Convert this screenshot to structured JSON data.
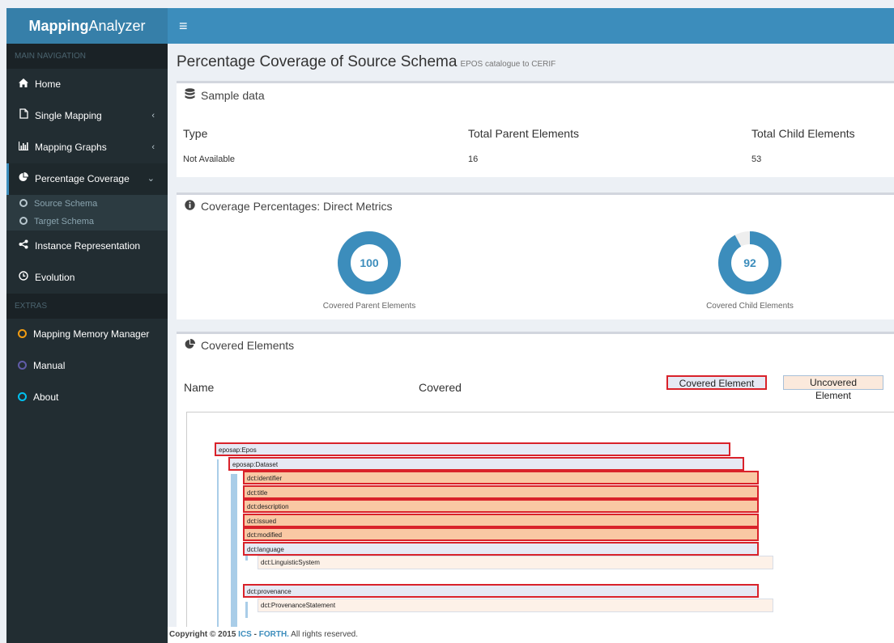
{
  "app": {
    "logo_bold": "Mapping",
    "logo_rest": "Analyzer"
  },
  "header": {
    "toggle_icon": "≡"
  },
  "sidebar": {
    "main_header": "MAIN NAVIGATION",
    "items": [
      {
        "label": "Home",
        "icon": "home-icon"
      },
      {
        "label": "Single Mapping",
        "icon": "file-icon"
      },
      {
        "label": "Mapping Graphs",
        "icon": "bar-chart-icon"
      },
      {
        "label": "Percentage Coverage",
        "icon": "pie-chart-icon"
      },
      {
        "label": "Instance Representation",
        "icon": "share-icon"
      },
      {
        "label": "Evolution",
        "icon": "clock-icon"
      }
    ],
    "sub_items": [
      {
        "label": "Source Schema"
      },
      {
        "label": "Target Schema"
      }
    ],
    "extras_header": "EXTRAS",
    "extras": [
      {
        "label": "Mapping Memory Manager",
        "color": "#f39c12"
      },
      {
        "label": "Manual",
        "color": "#605ca8"
      },
      {
        "label": "About",
        "color": "#00c0ef"
      }
    ]
  },
  "page": {
    "title": "Percentage Coverage of Source Schema",
    "subtitle": "EPOS catalogue to CERIF"
  },
  "sample": {
    "title": "Sample data",
    "headers": [
      "Type",
      "Total Parent Elements",
      "Total Child Elements"
    ],
    "values": [
      "Not Available",
      "16",
      "53"
    ]
  },
  "coverage": {
    "title": "Coverage Percentages: Direct Metrics",
    "parent": {
      "value": 100,
      "label": "Covered Parent Elements"
    },
    "child": {
      "value": 92,
      "label": "Covered Child Elements"
    },
    "color": "#3c8dbc"
  },
  "covered": {
    "title": "Covered Elements",
    "col_name": "Name",
    "col_covered": "Covered",
    "legend_covered": "Covered Element",
    "legend_uncovered": "Uncovered Element",
    "nodes": [
      {
        "label": "eposap:Epos",
        "kind": "parent"
      },
      {
        "label": "eposap:Dataset",
        "kind": "parent"
      },
      {
        "label": "dct:identifier",
        "kind": "leaf"
      },
      {
        "label": "dct:title",
        "kind": "leaf"
      },
      {
        "label": "dct:description",
        "kind": "leaf"
      },
      {
        "label": "dct:issued",
        "kind": "leaf"
      },
      {
        "label": "dct:modified",
        "kind": "leaf"
      },
      {
        "label": "dct:language",
        "kind": "parent"
      },
      {
        "label": "dct:LinguisticSystem",
        "kind": "unc"
      },
      {
        "label": "dct:provenance",
        "kind": "parent"
      },
      {
        "label": "dct:ProvenanceStatement",
        "kind": "unc"
      }
    ]
  },
  "footer": {
    "prefix": "Copyright © 2015 ",
    "ics": "ICS",
    "sep": " - ",
    "forth": "FORTH.",
    "suffix": " All rights reserved."
  }
}
